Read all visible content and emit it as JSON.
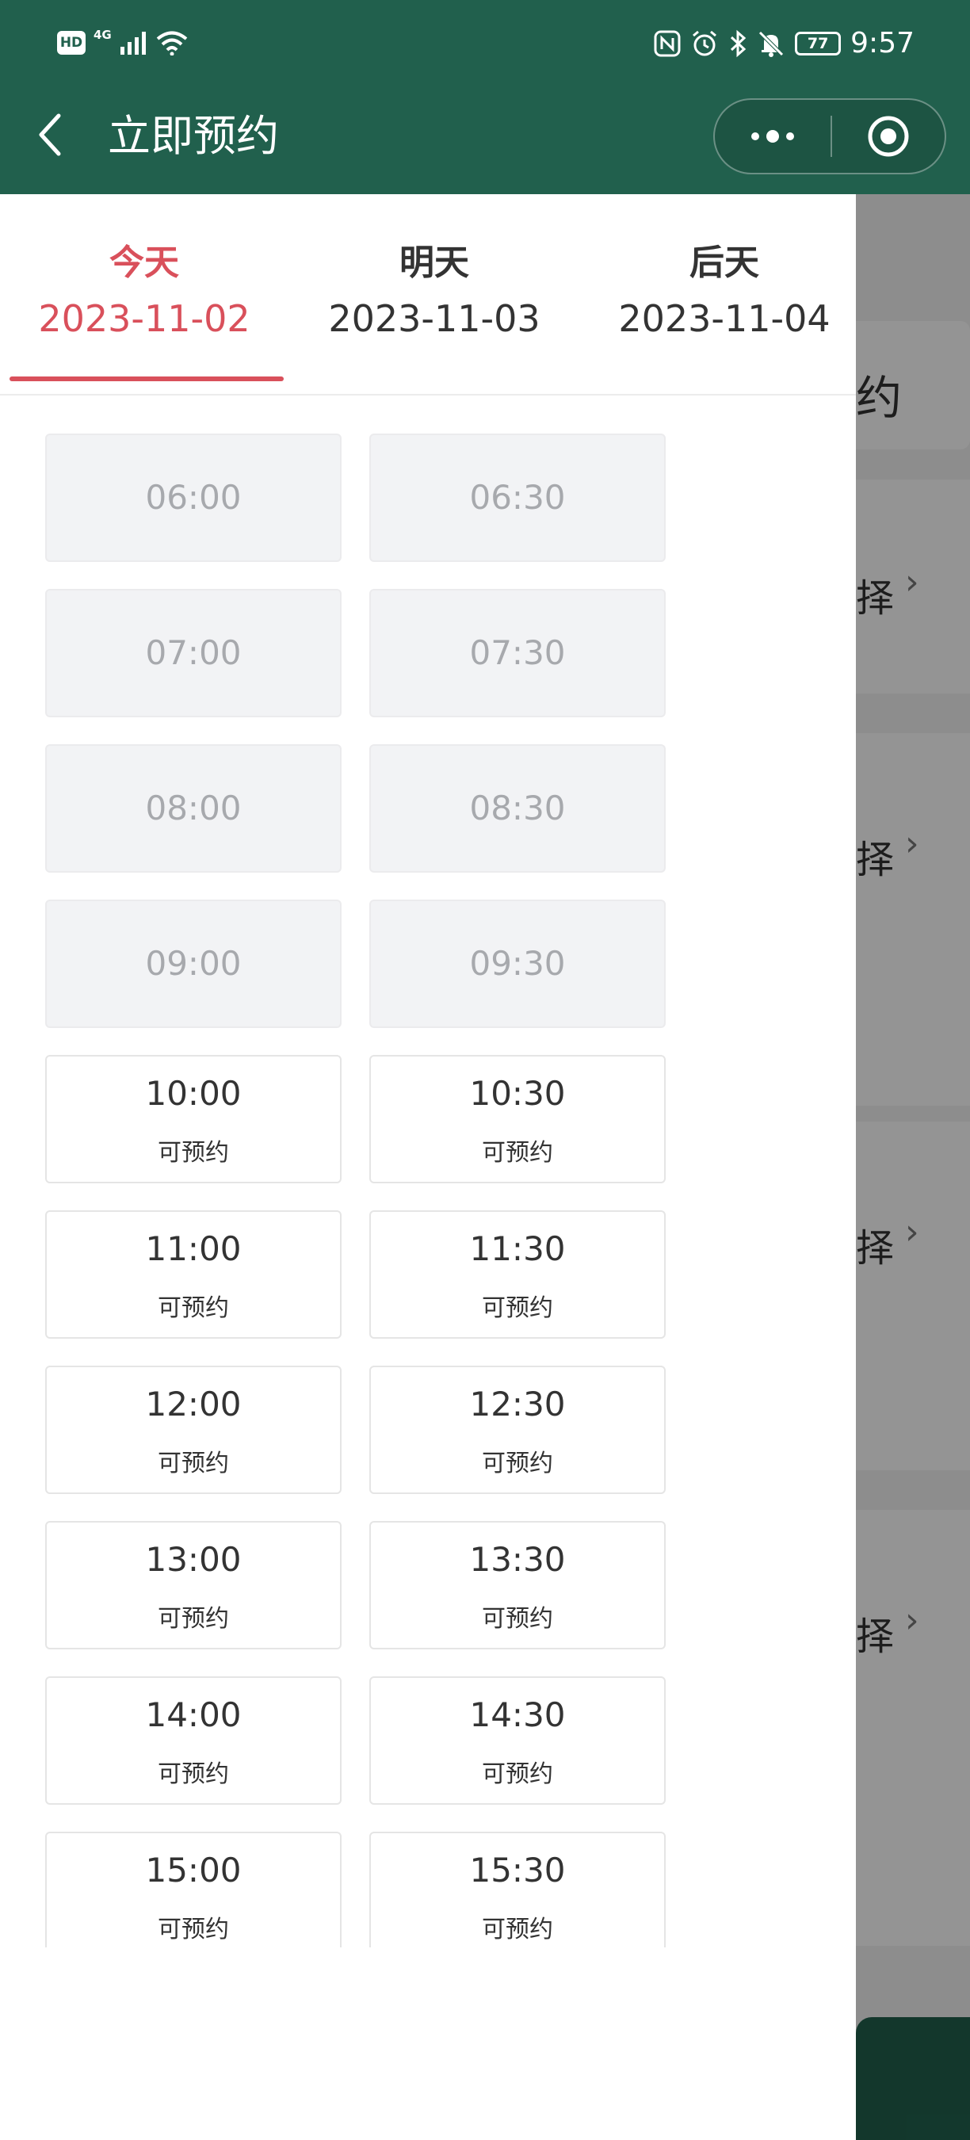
{
  "status_bar": {
    "hd": "HD",
    "network": "4G",
    "battery": "77",
    "time": "9:57"
  },
  "header": {
    "title": "立即预约"
  },
  "background_page": {
    "title_fragment": "约",
    "select_fragments": [
      "择",
      "择",
      "择",
      "择"
    ]
  },
  "tabs": [
    {
      "day": "今天",
      "date": "2023-11-02",
      "active": true
    },
    {
      "day": "明天",
      "date": "2023-11-03",
      "active": false
    },
    {
      "day": "后天",
      "date": "2023-11-04",
      "active": false
    }
  ],
  "slots": [
    {
      "time": "06:00",
      "status": "",
      "available": false
    },
    {
      "time": "06:30",
      "status": "",
      "available": false
    },
    {
      "time": "07:00",
      "status": "",
      "available": false
    },
    {
      "time": "07:30",
      "status": "",
      "available": false
    },
    {
      "time": "08:00",
      "status": "",
      "available": false
    },
    {
      "time": "08:30",
      "status": "",
      "available": false
    },
    {
      "time": "09:00",
      "status": "",
      "available": false
    },
    {
      "time": "09:30",
      "status": "",
      "available": false
    },
    {
      "time": "10:00",
      "status": "可预约",
      "available": true
    },
    {
      "time": "10:30",
      "status": "可预约",
      "available": true
    },
    {
      "time": "11:00",
      "status": "可预约",
      "available": true
    },
    {
      "time": "11:30",
      "status": "可预约",
      "available": true
    },
    {
      "time": "12:00",
      "status": "可预约",
      "available": true
    },
    {
      "time": "12:30",
      "status": "可预约",
      "available": true
    },
    {
      "time": "13:00",
      "status": "可预约",
      "available": true
    },
    {
      "time": "13:30",
      "status": "可预约",
      "available": true
    },
    {
      "time": "14:00",
      "status": "可预约",
      "available": true
    },
    {
      "time": "14:30",
      "status": "可预约",
      "available": true
    },
    {
      "time": "15:00",
      "status": "可预约",
      "available": true
    },
    {
      "time": "15:30",
      "status": "可预约",
      "available": true
    }
  ],
  "colors": {
    "header_green": "#21604d",
    "accent_red": "#d9505b",
    "disabled_bg": "#f2f3f5",
    "disabled_text": "#a7a9ad"
  }
}
